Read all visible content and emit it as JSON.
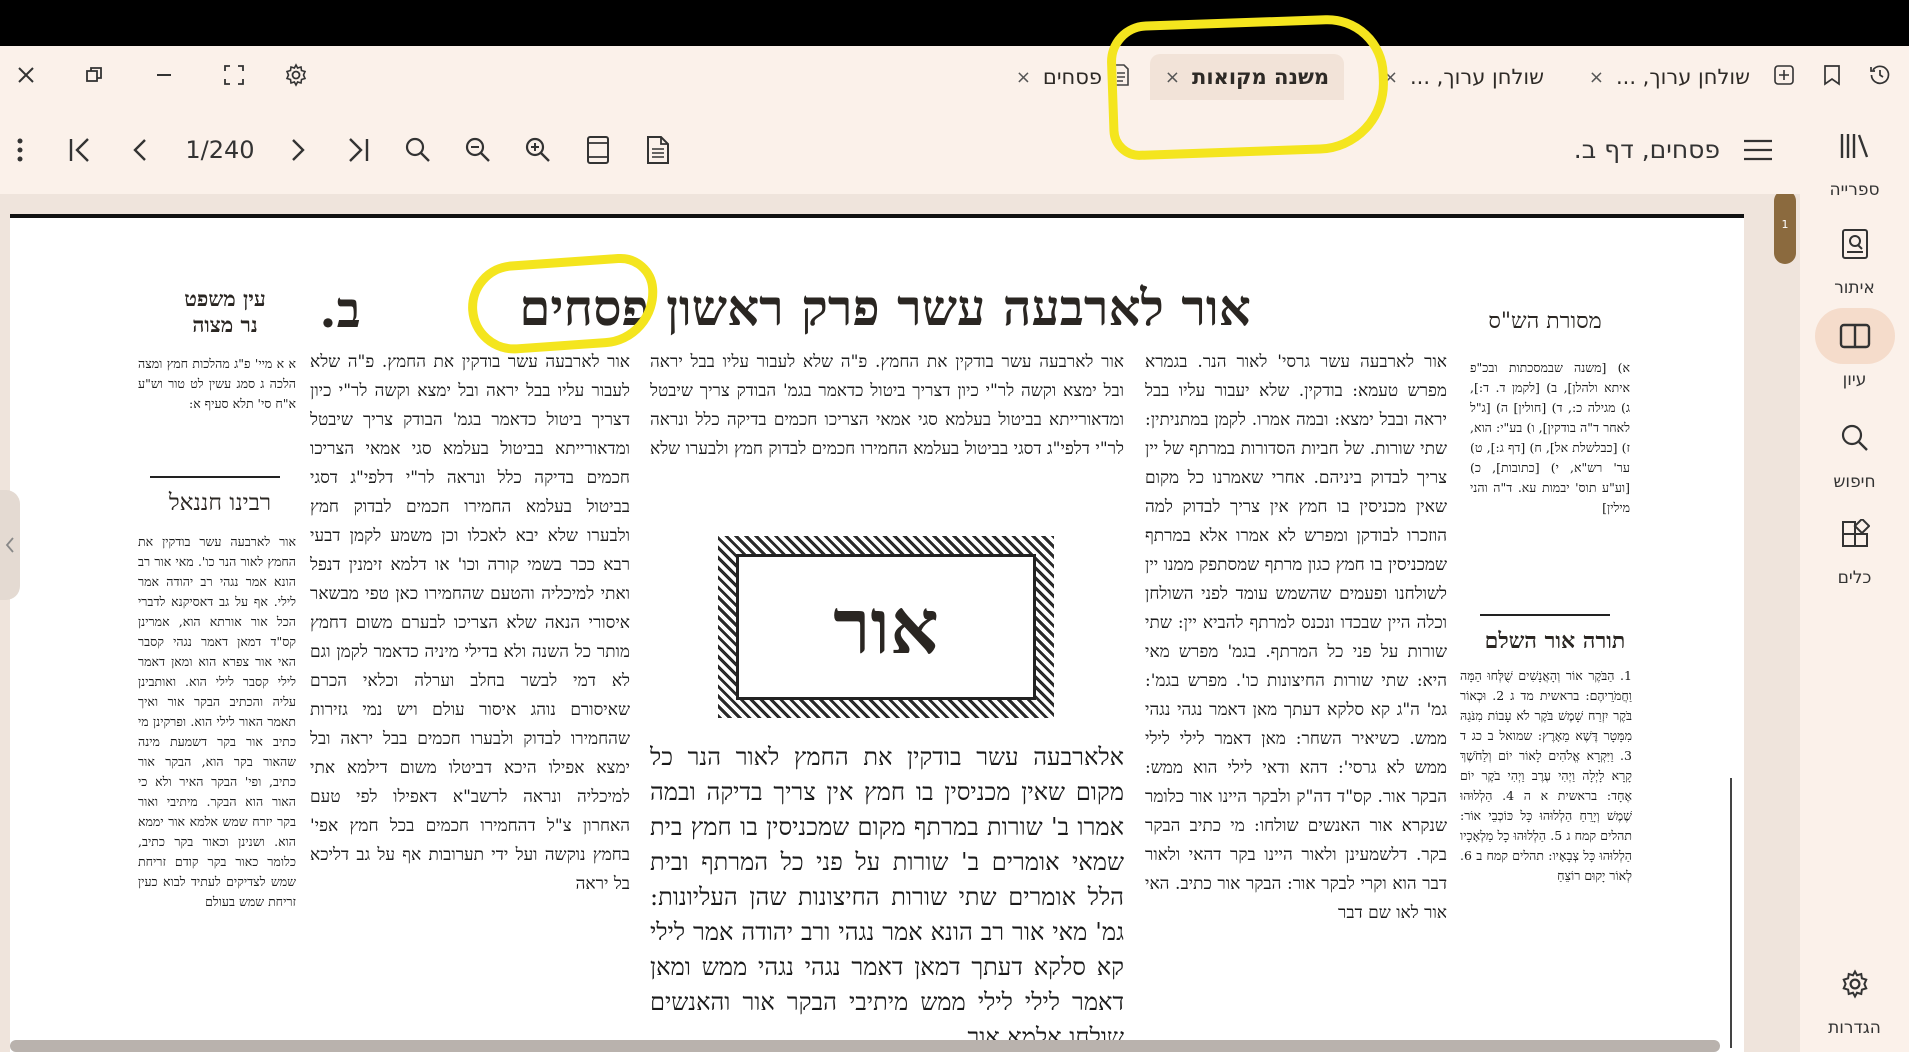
{
  "window": {
    "tabs": [
      {
        "label": "שולחן ערוך, ...",
        "active": false
      },
      {
        "label": "שולחן ערוך, ...",
        "active": false
      },
      {
        "label": "משנה מקואות",
        "active": true
      },
      {
        "label": "פסחים",
        "active": false
      }
    ],
    "tab_close": "×"
  },
  "toolbar": {
    "page_indicator": "1/240",
    "document_title": "פסחים, דף ב."
  },
  "sidebar": {
    "items": [
      {
        "label": "ספרייה",
        "icon": "library-icon"
      },
      {
        "label": "איתור",
        "icon": "locate-icon"
      },
      {
        "label": "עיון",
        "icon": "book-open-icon"
      },
      {
        "label": "חיפוש",
        "icon": "search-icon"
      },
      {
        "label": "כלים",
        "icon": "tools-icon"
      },
      {
        "label": "הגדרות",
        "icon": "gear-icon"
      }
    ]
  },
  "scroll": {
    "page_marker": "1"
  },
  "page": {
    "masoret_header": "מסורת הש\"ס",
    "main_header": "אור לארבעה עשר   פרק ראשון   פסחים",
    "daf": "ב.",
    "ein_mishpat": "עין משפט",
    "ner_mitzvah": "נר מצוה",
    "rabbenu_chananel": "רבינו חננאל",
    "torah_or": "תורה אור השלם",
    "or_word": "אור",
    "mishnah_text": "אלארבעה עשר בודקין את החמץ לאור הנר כל מקום שאין מכניסין בו חמץ אין צריך בדיקה ובמה אמרו ב' שורות במרתף מקום שמכניסין בו חמץ בית שמאי אומרים ב' שורות על פני כל המרתף ובית הלל אומרים שתי שורות החיצונות שהן העליונות: גמ' מאי אור רב הונא אמר נגהי ורב יהודה אמר לילי קא סלקא דעתך דמאן דאמר נגהי נגהי ממש ומאן דאמר לילי לילי ממש מיתיבי הבקר אור והאנשים שולחו אלמא אור",
    "rashi_text": "אור לארבעה עשר גרסי' לאור הנר. בגמרא מפרש טעמא: בודקין. שלא יעבור עליו בבל יראה ובבל ימצא: ובמה אמרו. לקמן במתניתין: שתי שורות. של חביות הסדורות במרתף של יין צריך לבדוק ביניהם. אחרי שאמרנו כל מקום שאין מכניסין בו חמץ אין צריך לבדוק למה הוזכרו לבודקן ומפרש לא אמרו אלא במרתף שמכניסין בו חמץ כגון מרתף שמסתפק ממנו יין לשולחנו ופעמים שהשמש עומד לפני השולחן וכלה היין שבכדו ונכנס למרתף להביא יין: שתי שורות על פני כל המרתף. בגמ' מפרש מאי היא: שתי שורות החיצונות כו'. מפרש בגמ': גמ' ה\"ג קא סלקא דעתך מאן דאמר נגהי נגהי ממש. כשיאיר השחר: מאן דאמר לילי לילי ממש לא גרסי': דהא ודאי לילי הוא ממש: הבקר אור. קס\"ד דה\"ק ולבקר היינו אור כלומר שנקרא אור האנשים שולחו: מי כתיב הבקר בקר. דלשמעינן ולאור היינו בקר דהאי ולאור דבר הוא וקרי לבקר אור: הבקר אור כתיב. האי אור לאו שם דבר",
    "tosafot_text": "אור לארבעה עשר בודקין את החמץ. פ\"ה שלא לעבור עליו בבל יראה ובל ימצא וקשה לר\"י כיון דצריך ביטול כדאמר בגמ' הבודק צריך שיבטל ומדאורייתא בביטול בעלמא סגי אמאי הצריכו חכמים בדיקה כלל ונראה לר\"י דלפי\"ג דסגי בביטול בעלמא החמירו חכמים לבדוק חמץ ולבערו שלא יבא לאכלו וכן משמע לקמן דבעי רבא ככר בשמי קורה וכו' או דלמא זימנין דנפל ואתי למיכליה והטעם שהחמירו כאן טפי מבשאר איסורי הנאה שלא הצריכו לבערם משום דחמץ מותר כל השנה ולא בדילי מיניה כדאמר לקמן וגם לא דמי לבשר בחלב וערלה וכלאי הכרם שאיסורם נוהג איסור עולם ויש נמי גזירות שהחמירו לבדוק ולבערו חכמים בבל יראה ובל ימצא אפילו היכא דביטלו משום דילמא אתי למיכליה ונראה לרשב\"א דאפילו לפי טעם האחרון צ\"ל דהחמירו חכמים בכל חמץ אפי' בחמץ נוקשה ועל ידי תערובות אף על גב דליכא בל יראה",
    "ein_mishpat_text": "א א מיי' פ\"ג מהלכות חמץ ומצה הלכה ג סמג עשין לט טור וש\"ע א\"ח סי' תלא סעיף א:",
    "rabbenu_text": "אור לארבעה עשר בודקין את החמץ לאור הנר כו'. מאי אור רב הונא אמר נגהי רב יהודה אמר לילי. אף על גב דאסיקנא לדברי הכל אור אורתא הוא, אמרינן קס\"ד דמאן דאמר נגהי קסבר האי אור צפרא הוא ומאן דאמר לילי קסבר לילי הוא. ואותבינן עליה והכתיב הבקר אור ואיך תאמר האור לילי הוא. ופרקינן מי כתיב אור בקר דשמעת מינה שהאור בקר הוא, הבקר אור כתיב, ופי' הבקר האיר ולא כי האור הוא הבקר. מיתיבי ואור בקר יזרח שמש אלמא אור יממא הוא. ושנינן וכאור בקר כתיב, כלומר כאור בקר קודם זריחת שמש לצדיקים לעתיד לבוא כעין זריחת שמש בעולם",
    "masoret_text": "א) [משנה שבמסכתות ובכ\"פ איתא ולהלן], ב) [לקמן ד. ד:], ג) מגילה כ:, ד) [חולין] ה) [ג\"ל לאחר ד\"ה בודקין], ו) בע\"י: הוא, ז) [כבלשלת אל], ח) [דף ג:], ט) ער' רש\"א, י) [כתובות], כ) [וע\"ע תוס' יבמות עא. ד\"ה והני מילין]",
    "torah_or_text": "1. הַבֹּקֶר אוֹר וְהָאֲנָשִׁים שֻׁלְּחוּ הֵמָּה וַחֲמֹרֵיהֶם: בראשית מד ג 2. וּכְאוֹר בֹּקֶר יִזְרַח שָׁמֶשׁ בֹּקֶר לֹא עָבוֹת מִנֹּגַהּ מִמָּטָר דֶּשֶׁא מֵאָרֶץ: שמואל ב כג ד 3. וַיִּקְרָא אֱלֹהִים לָאוֹר יוֹם וְלַחֹשֶׁךְ קָרָא לָיְלָה וַיְהִי עֶרֶב וַיְהִי בֹקֶר יוֹם אֶחָד: בראשית א ה 4. הַלְלוּהוּ שֶׁמֶשׁ וְיָרֵחַ הַלְלוּהוּ כָּל כּוֹכְבֵי אוֹר: תהלים קמח ג 5. הַלְלוּהוּ כָל מַלְאָכָיו הַלְלוּהוּ כָּל צְבָאָיו: תהלים קמח ב 6. לְאוֹר יָקוּם רוֹצֵחַ"
  }
}
